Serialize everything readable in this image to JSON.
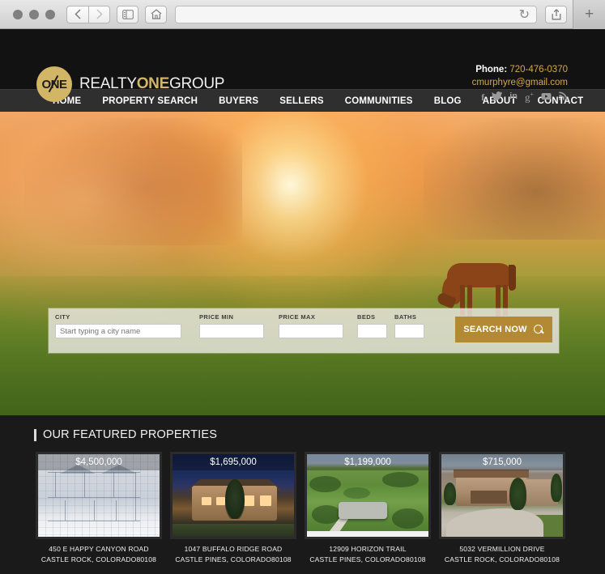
{
  "browser": {
    "back_icon": "chevron-left",
    "forward_icon": "chevron-right",
    "sidebar_icon": "sidebar",
    "home_icon": "home",
    "url_value": "",
    "url_placeholder": "",
    "reload_icon": "↻",
    "share_icon": "share",
    "tabs_icon": "tabs",
    "newtab_label": "+"
  },
  "header": {
    "logo_mark_text": "ONE",
    "brand_part1": "REALTY",
    "brand_part2": "ONE",
    "brand_part3": "GROUP",
    "phone_label": "Phone:",
    "phone_number": "720-476-0370",
    "email": "cmurphyre@gmail.com",
    "socials": [
      {
        "name": "facebook-icon",
        "glyph": "f"
      },
      {
        "name": "twitter-icon",
        "glyph": "ᵕ"
      },
      {
        "name": "linkedin-icon",
        "glyph": "in"
      },
      {
        "name": "googleplus-icon",
        "glyph": "g⁺"
      },
      {
        "name": "youtube-icon",
        "glyph": "▶"
      },
      {
        "name": "rss-icon",
        "glyph": "≋"
      }
    ],
    "accent_gold": "#d3b566",
    "link_gold": "#d3a94a"
  },
  "nav": {
    "items": [
      {
        "label": "HOME"
      },
      {
        "label": "PROPERTY SEARCH"
      },
      {
        "label": "BUYERS"
      },
      {
        "label": "SELLERS"
      },
      {
        "label": "COMMUNITIES"
      },
      {
        "label": "BLOG"
      },
      {
        "label": "ABOUT"
      },
      {
        "label": "CONTACT"
      }
    ]
  },
  "hero": {
    "description": "sunrise over misty field with grazing horse"
  },
  "search": {
    "city_label": "CITY",
    "city_placeholder": "Start typing a city name",
    "city_value": "",
    "price_min_label": "PRICE MIN",
    "price_min_value": "",
    "price_max_label": "PRICE MAX",
    "price_max_value": "",
    "beds_label": "BEDS",
    "beds_value": "",
    "baths_label": "BATHS",
    "baths_value": "",
    "button_label": "SEARCH NOW",
    "button_color": "#b38a33"
  },
  "featured": {
    "title": "OUR FEATURED PROPERTIES",
    "cards": [
      {
        "price": "$4,500,000",
        "address_line1": "450 E HAPPY CANYON ROAD",
        "address_line2": "CASTLE ROCK, COLORADO80108"
      },
      {
        "price": "$1,695,000",
        "address_line1": "1047 BUFFALO RIDGE ROAD",
        "address_line2": "CASTLE PINES, COLORADO80108"
      },
      {
        "price": "$1,199,000",
        "address_line1": "12909 HORIZON TRAIL",
        "address_line2": "CASTLE PINES, COLORADO80108"
      },
      {
        "price": "$715,000",
        "address_line1": "5032 VERMILLION DRIVE",
        "address_line2": "CASTLE ROCK, COLORADO80108"
      }
    ]
  }
}
